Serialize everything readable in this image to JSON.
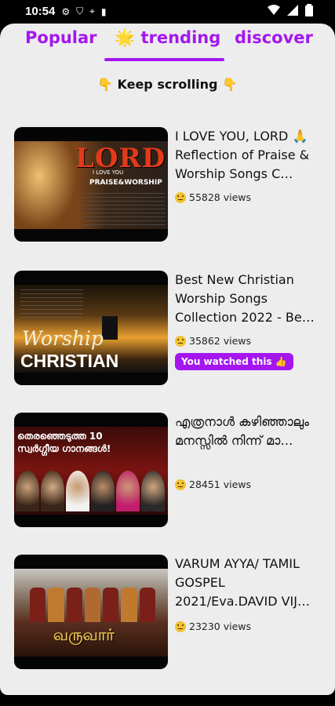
{
  "status_bar": {
    "time": "10:54"
  },
  "tabs": [
    {
      "label": "Popular",
      "active": false
    },
    {
      "label": "🌟 trending",
      "active": true
    },
    {
      "label": "discover",
      "active": false
    }
  ],
  "hint": "👇 Keep scrolling 👇",
  "accent_color": "#a516ef",
  "videos": [
    {
      "title": "I LOVE YOU, LORD 🙏 Reflection of Praise & Worship Songs C…",
      "views": "55828 views",
      "thumb_text": {
        "big": "LORD",
        "small": "I LOVE YOU",
        "tag": "PRAISE&WORSHIP"
      }
    },
    {
      "title": "Best New Christian Worship Songs Collection 2022 - Be…",
      "views": "35862 views",
      "watched_badge": "You watched this 👍",
      "thumb_text": {
        "script": "Worship",
        "big": "CHRISTIAN"
      }
    },
    {
      "title": "എത്രനാൾ കഴിഞ്ഞാലും മനസ്സിൽ നിന്ന് മാ…",
      "views": "28451 views",
      "thumb_text": {
        "big": "തെരഞ്ഞെടുത്ത 10 സ്വർഗ്ഗീയ ഗാനങ്ങൾ!"
      }
    },
    {
      "title": "VARUM AYYA/ TAMIL GOSPEL 2021/Eva.DAVID VIJ…",
      "views": "23230 views",
      "thumb_text": {
        "big": "வருவார்"
      }
    }
  ]
}
